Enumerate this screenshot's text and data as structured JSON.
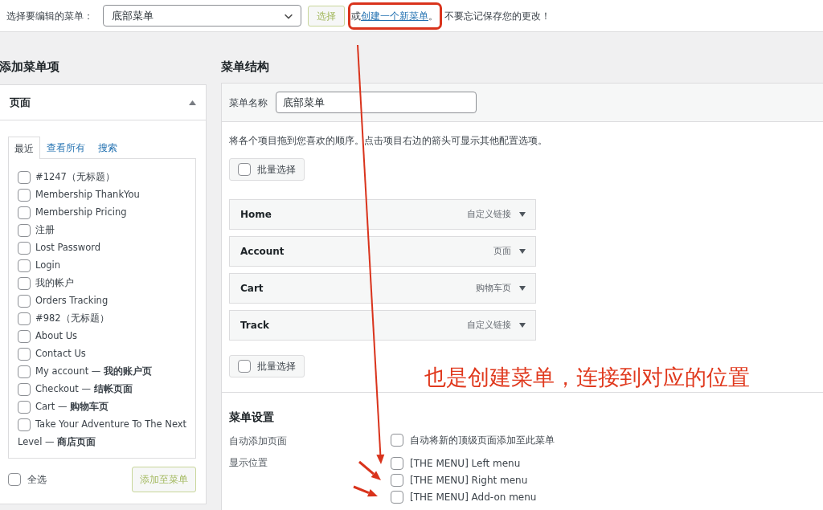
{
  "top_bar": {
    "label": "选择要编辑的菜单：",
    "menu_select": {
      "value": "底部菜单"
    },
    "select_button": "选择",
    "hint": {
      "prefix": "或",
      "link": "创建一个新菜单",
      "period": "。",
      "suffix": "不要忘记保存您的更改！"
    }
  },
  "add_items": {
    "title": "添加菜单项",
    "section": {
      "title": "页面",
      "expanded": true
    },
    "tabs": [
      {
        "label": "最近",
        "selected": true
      },
      {
        "label": "查看所有",
        "selected": false
      },
      {
        "label": "搜索",
        "selected": false
      }
    ],
    "pages": [
      {
        "label": "#1247（无标题）",
        "checked": false
      },
      {
        "label": "Membership ThankYou",
        "checked": false
      },
      {
        "label": "Membership Pricing",
        "checked": false
      },
      {
        "label": "注册",
        "checked": false
      },
      {
        "label": "Lost Password",
        "checked": false
      },
      {
        "label": "Login",
        "checked": false
      },
      {
        "label": "我的帐户",
        "checked": false
      },
      {
        "label": "Orders Tracking",
        "checked": false
      },
      {
        "label": "#982（无标题）",
        "checked": false
      },
      {
        "label": "About Us",
        "checked": false
      },
      {
        "label": "Contact Us",
        "checked": false
      },
      {
        "label": "My account — **我的账户页**",
        "checked": false
      },
      {
        "label": "Checkout — **结帐页面**",
        "checked": false
      },
      {
        "label": "Cart — **购物车页**",
        "checked": false
      },
      {
        "label": "Take Your Adventure To The Next",
        "continuation": "Level — **商店页面**",
        "checked": false
      }
    ],
    "select_all": {
      "label": "全选",
      "checked": false
    },
    "add_button": "添加至菜单"
  },
  "menu_structure": {
    "title": "菜单结构",
    "name_label": "菜单名称",
    "name_value": "底部菜单",
    "instructions": "将各个项目拖到您喜欢的顺序。点击项目右边的箭头可显示其他配置选项。",
    "bulk_select_top": {
      "label": "批量选择",
      "checked": false
    },
    "items": [
      {
        "title": "Home",
        "type": "自定义链接"
      },
      {
        "title": "Account",
        "type": "页面"
      },
      {
        "title": "Cart",
        "type": "购物车页"
      },
      {
        "title": "Track",
        "type": "自定义链接"
      }
    ],
    "bulk_select_bottom": {
      "label": "批量选择",
      "checked": false
    },
    "settings": {
      "title": "菜单设置",
      "rows": [
        {
          "label": "自动添加页面",
          "options": [
            {
              "label": "自动将新的顶级页面添加至此菜单",
              "checked": false
            }
          ]
        },
        {
          "label": "显示位置",
          "options": [
            {
              "label": "[THE MENU] Left menu",
              "checked": false
            },
            {
              "label": "[THE MENU] Right menu",
              "checked": false
            },
            {
              "label": "[THE MENU] Add-on menu",
              "checked": false
            }
          ]
        }
      ]
    }
  },
  "annotation": {
    "text": "也是创建菜单，连接到对应的位置"
  }
}
